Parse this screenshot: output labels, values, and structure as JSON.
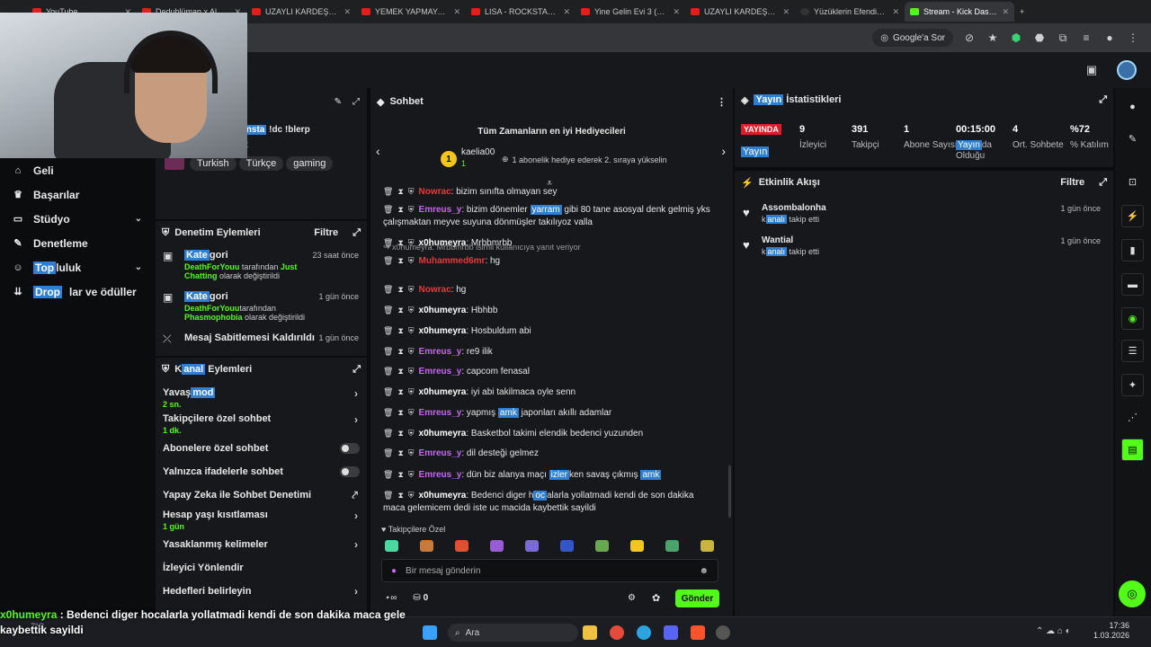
{
  "browser": {
    "tabs": [
      {
        "title": "YouTube",
        "icon": "youtube-icon"
      },
      {
        "title": "Dedublüman x Al",
        "icon": "youtube-icon"
      },
      {
        "title": "UZAYLI KARDEŞLERİ",
        "icon": "youtube-icon"
      },
      {
        "title": "YEMEK YAPMAYA GE",
        "icon": "youtube-icon"
      },
      {
        "title": "LISA - ROCKSTAR (O",
        "icon": "youtube-icon"
      },
      {
        "title": "Yine Gelin Evi 3 (214",
        "icon": "youtube-icon"
      },
      {
        "title": "UZAYLI KARDEŞLERİ",
        "icon": "youtube-icon"
      },
      {
        "title": "Yüzüklerin Efendisi Y",
        "icon": "dark-icon"
      },
      {
        "title": "Stream - Kick Dashb",
        "icon": "kick-icon",
        "active": true
      }
    ],
    "search_pill": "Google'a Sor"
  },
  "leftnav": {
    "items": [
      {
        "label": "Geli",
        "icon": "home-icon"
      },
      {
        "label": "Başarılar",
        "icon": "trophy-icon"
      },
      {
        "label": "Stüdyo",
        "icon": "monitor-icon",
        "chevron": true
      },
      {
        "label": "Denetleme",
        "icon": "wrench-icon"
      },
      {
        "label": "Topluluk",
        "icon": "users-icon",
        "chevron": true,
        "hl": "Top",
        "rest": "luluk"
      },
      {
        "label": "Drop",
        "icon": "drop-icon",
        "hl": "Drop",
        "rest": "lar ve ödüller"
      }
    ]
  },
  "stream_info": {
    "title_prefix": "insta",
    "title_rest": " !dc !blerp",
    "line2": "t",
    "tags": [
      "Turkish",
      "Türkçe",
      "gaming"
    ]
  },
  "mod_actions": {
    "title": "Denetim Eylemleri",
    "filter": "Filtre",
    "items": [
      {
        "kind_hl": "Kate",
        "kind_rest": "gori",
        "time": "23 saat önce",
        "user": "DeathForYouu",
        "mid": " tarafından ",
        "target": "Just Chatting",
        "end": " olarak değiştirildi"
      },
      {
        "kind_hl": "Kate",
        "kind_rest": "gori",
        "time": "1 gün önce",
        "user": "DeathForYouu",
        "mid": "tarafından ",
        "target": "Phasmophobia",
        "end": " olarak değiştirildi"
      },
      {
        "label": "Mesaj Sabitlemesi Kaldırıldı",
        "time": "1 gün önce"
      }
    ]
  },
  "channel_actions": {
    "title_a": "K",
    "title_hl": "anal",
    "title_b": " Eylemleri",
    "settings": [
      {
        "label_a": "Yavaş ",
        "label_hl": "mod",
        "sub": "2 sn.",
        "type": "arrow"
      },
      {
        "label": "Takipçilere özel sohbet",
        "sub": "1 dk.",
        "type": "arrow"
      },
      {
        "label": "Abonelere özel sohbet",
        "type": "toggle"
      },
      {
        "label": "Yalnızca ifadelerle sohbet",
        "type": "toggle"
      },
      {
        "label": "Yapay Zeka ile Sohbet Denetimi",
        "type": "external"
      },
      {
        "label": "Hesap yaşı kısıtlaması",
        "sub": "1 gün",
        "type": "arrow"
      },
      {
        "label": "Yasaklanmış kelimeler",
        "type": "arrow"
      },
      {
        "label": "İzleyici Yönlendir",
        "type": "none"
      },
      {
        "label": "Hedefleri belirleyin",
        "type": "arrow"
      }
    ]
  },
  "chat": {
    "title": "Sohbet",
    "top_gifters_title": "Tüm Zamanların en iyi Hediyecileri",
    "top_gifter_rank": "1",
    "top_gifter_name": "kaelia00",
    "top_gifter_count": "1",
    "top_gifter_hint": "1 abonelik hediye ederek 2. sıraya yükselin",
    "messages": [
      {
        "user": "Nowrac",
        "ucls": "u-red",
        "text": "bizim sınıfta olmayan sey"
      },
      {
        "user": "Emreus_y",
        "ucls": "u-purple",
        "text_a": "bizim dönemler ",
        "hl": "yarram",
        "text_b": " gibi 80 tane asosyal denk gelmiş yks çalışmaktan meyve suyuna dönmüşler takılıyoz valla"
      },
      {
        "user": "x0humeyra",
        "ucls": "u-white",
        "text": "Mrbbmrbb"
      },
      {
        "reply": "x0humeyra: Mrbbmrbb isimli kullanıcıya yanıt veriyor",
        "user": "Muhammed6mr",
        "ucls": "u-red",
        "text": "hg"
      },
      {
        "user": "Nowrac",
        "ucls": "u-red",
        "text": "hg"
      },
      {
        "user": "x0humeyra",
        "ucls": "u-white",
        "text": "Hbhbb"
      },
      {
        "user": "x0humeyra",
        "ucls": "u-white",
        "text": "Hosbuldum abi"
      },
      {
        "user": "Emreus_y",
        "ucls": "u-purple",
        "text": "re9 ilik"
      },
      {
        "user": "Emreus_y",
        "ucls": "u-purple",
        "text": "capcom fenasal"
      },
      {
        "user": "x0humeyra",
        "ucls": "u-white",
        "text": "iyi abi takilmaca oyle senn"
      },
      {
        "user": "Emreus_y",
        "ucls": "u-purple",
        "text_a": "yapmış ",
        "hl": "amk",
        "text_b": " japonları akıllı adamlar"
      },
      {
        "user": "x0humeyra",
        "ucls": "u-white",
        "text": "Basketbol takimi elendik bedenci yuzunden"
      },
      {
        "user": "Emreus_y",
        "ucls": "u-purple",
        "text": "dil desteği gelmez"
      },
      {
        "user": "Emreus_y",
        "ucls": "u-purple",
        "text_a": "dün biz alanya maçı ",
        "hl": "izler",
        "text_b": "ken savaş çıkmış ",
        "hl2": "amk"
      },
      {
        "user": "x0humeyra",
        "ucls": "u-white",
        "text_a": "Bedenci diger h",
        "hl": "oc",
        "text_b": "alarla yollatmadi kendi de son dakika maca gelemicem dedi iste uc macida kaybettik sayildi"
      }
    ],
    "followers_only": "Takipçilere Özel",
    "placeholder": "Bir mesaj gönderin",
    "points": "0",
    "send": "Gönder"
  },
  "stats": {
    "title_hl": "Yayın",
    "title_rest": " İstatistikleri",
    "badge_a": "YAYIN",
    "badge_b": "DA",
    "badge2": "Yayın",
    "items": [
      {
        "value": "9",
        "label": "İzleyici"
      },
      {
        "value": "391",
        "label": "Takipçi"
      },
      {
        "value": "1",
        "label": "Abone Sayısı"
      },
      {
        "value": "00:15:00",
        "label_hl": "Yayın",
        "label_rest": "da Olduğu"
      },
      {
        "value": "4",
        "label": "Ort. Sohbete"
      },
      {
        "value": "%72",
        "label": "% Katılım"
      }
    ]
  },
  "activity": {
    "title": "Etkinlik Akışı",
    "filter": "Filtre",
    "items": [
      {
        "name": "Assombalonha",
        "pre": "k",
        "hl": "analı",
        "post": " takip etti",
        "time": "1 gün önce"
      },
      {
        "name": "Wantial",
        "pre": "k",
        "hl": "analı",
        "post": " takip etti",
        "time": "1 gün önce"
      }
    ]
  },
  "overlay": {
    "user": "x0humeyra",
    "text": " : Bedenci diger hocalarla yollatmadi kendi de son dakika maca gele kaybettik sayildi"
  },
  "taskbar": {
    "search": "Ara",
    "weather": "7°C",
    "time": "17:36",
    "date": "1.03.2026"
  },
  "colors": {
    "accent": "#53fc18",
    "highlight": "#2e7fd1",
    "live": "#e01b2b"
  }
}
